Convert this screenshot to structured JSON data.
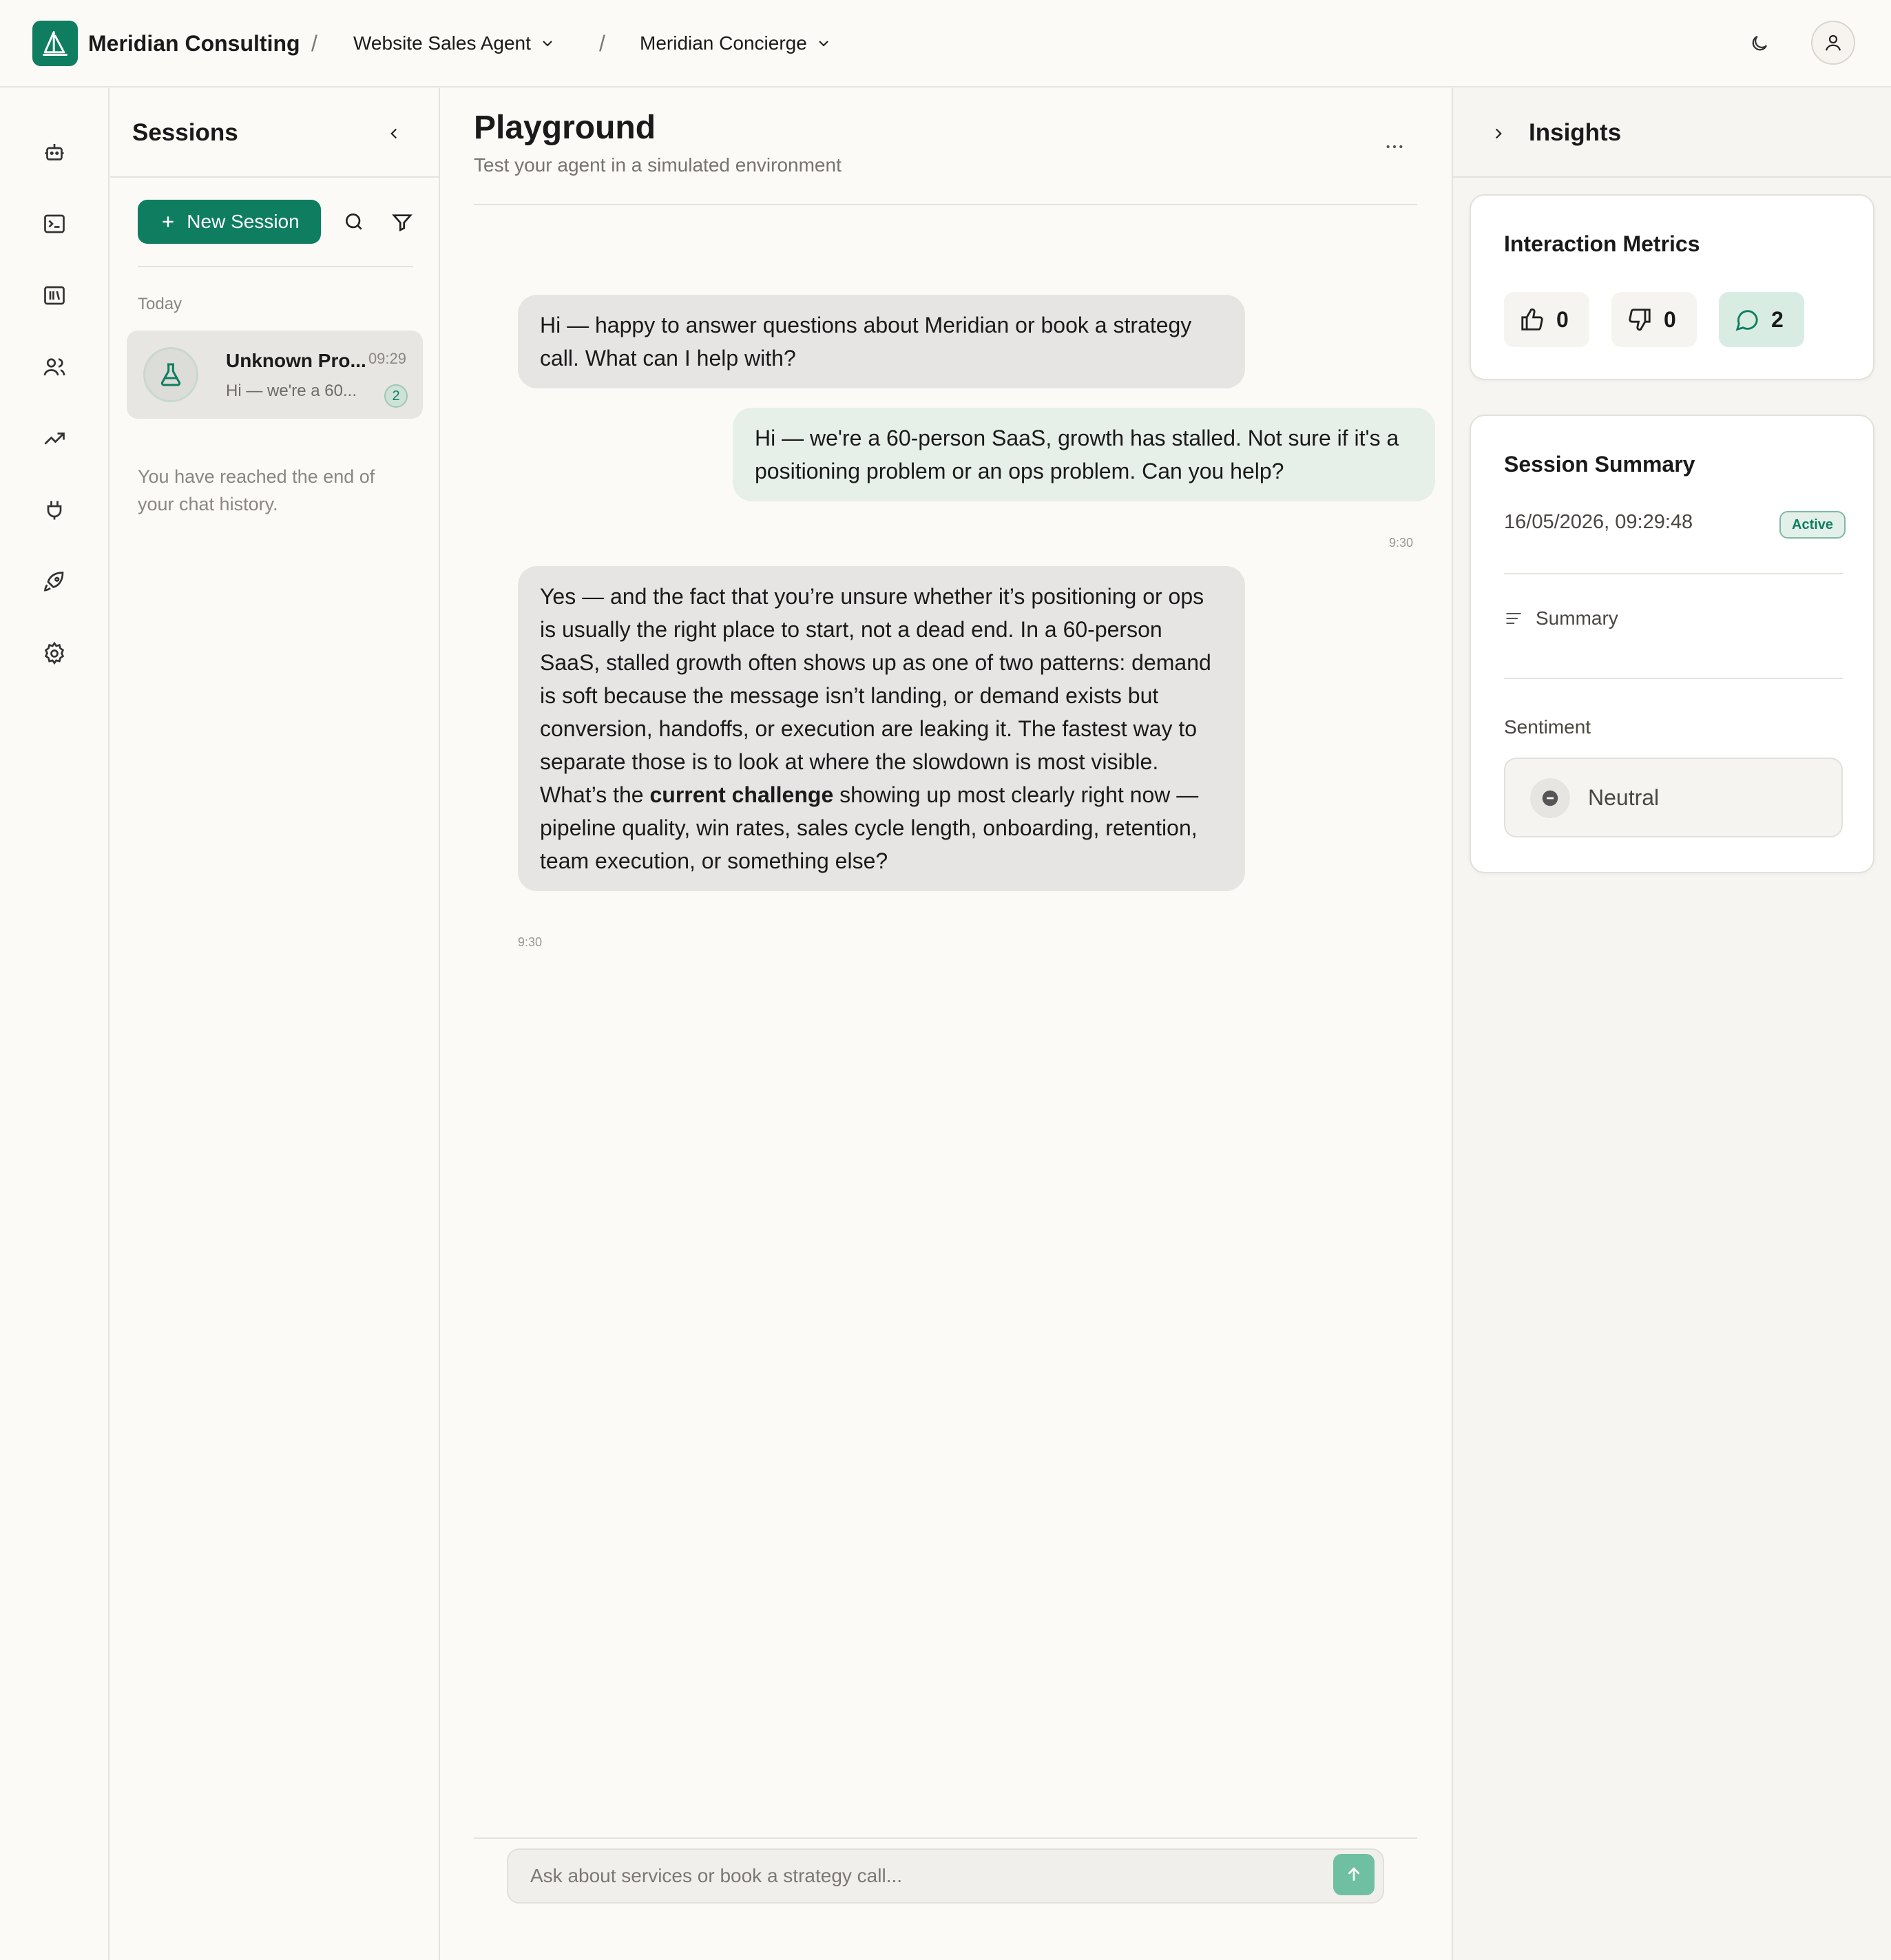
{
  "app": {
    "org_name": "Meridian Consulting",
    "breadcrumb_sep": "/",
    "agent_selector": "Website Sales Agent",
    "persona_selector": "Meridian Concierge",
    "brand_color": "#0f7d5f"
  },
  "rail": {
    "items": [
      "robot-icon",
      "terminal-icon",
      "library-icon",
      "users-icon",
      "trending-icon",
      "plug-icon",
      "rocket-icon",
      "settings-icon"
    ]
  },
  "sessions": {
    "title": "Sessions",
    "new_session_label": "New Session",
    "group_label": "Today",
    "items": [
      {
        "name": "Unknown Pro...",
        "time": "09:29",
        "preview": "Hi — we're a 60...",
        "count": "2"
      }
    ],
    "end_text": "You have reached the end of your chat history."
  },
  "main": {
    "title": "Playground",
    "subtitle": "Test your agent in a simulated environment",
    "messages": [
      {
        "role": "agent",
        "text": "Hi — happy to answer questions about Meridian or book a strategy call. What can I help with?"
      },
      {
        "role": "user",
        "text": "Hi — we're a 60-person SaaS, growth has stalled. Not sure if it's a positioning problem or an ops problem. Can you help?",
        "time": "9:30"
      },
      {
        "role": "agent",
        "paragraph1": "Yes — and the fact that you’re unsure whether it’s positioning or ops is usually the right place to start, not a dead end. In a 60-person SaaS, stalled growth often shows up as one of two patterns: demand is soft because the message isn’t landing, or demand exists but conversion, handoffs, or execution are leaking it. The fastest way to separate those is to look at where the slowdown is most visible.",
        "paragraph2_pre": "What’s the ",
        "paragraph2_bold": "current challenge",
        "paragraph2_post": " showing up most clearly right now — pipeline quality, win rates, sales cycle length, onboarding, retention, team execution, or something else?",
        "time": "9:30"
      }
    ],
    "composer_placeholder": "Ask about services or book a strategy call..."
  },
  "insights": {
    "title": "Insights",
    "metrics_title": "Interaction Metrics",
    "thumbs_up": "0",
    "thumbs_down": "0",
    "messages": "2",
    "summary_title": "Session Summary",
    "session_date": "16/05/2026, 09:29:48",
    "status": "Active",
    "summary_label": "Summary",
    "sentiment_label": "Sentiment",
    "sentiment_value": "Neutral"
  }
}
